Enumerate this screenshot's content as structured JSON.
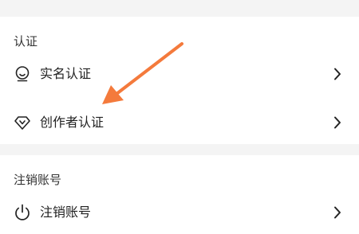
{
  "auth_section": {
    "title": "认证",
    "items": [
      {
        "label": "实名认证",
        "icon": "face-id-icon"
      },
      {
        "label": "创作者认证",
        "icon": "creator-badge-icon"
      }
    ]
  },
  "cancel_section": {
    "title": "注销账号",
    "items": [
      {
        "label": "注销账号",
        "icon": "power-icon"
      }
    ]
  },
  "annotation": {
    "arrow_color": "#f47a3c"
  }
}
